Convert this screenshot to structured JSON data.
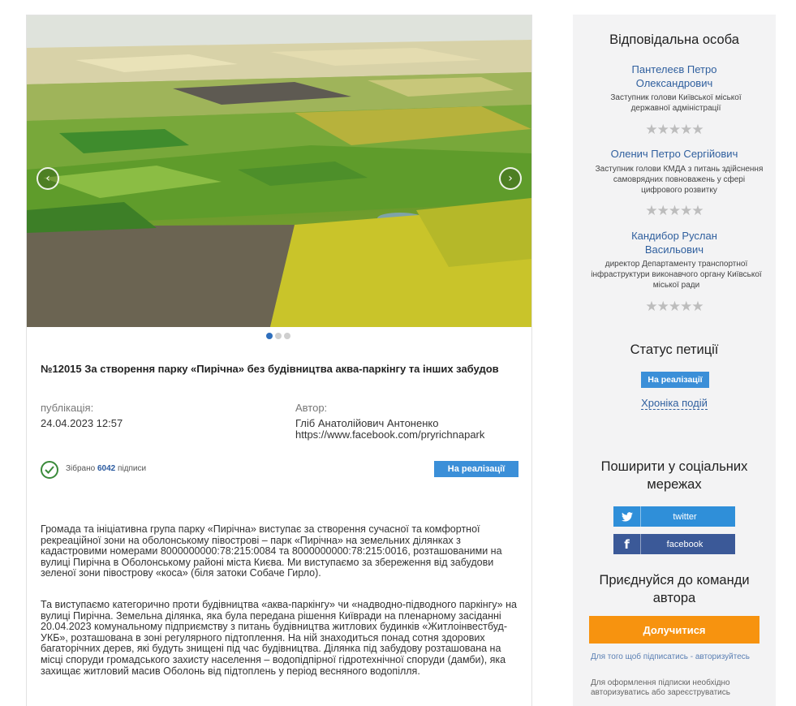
{
  "carousel": {
    "prev_icon": "chevron-left-icon",
    "next_icon": "chevron-right-icon",
    "slides_count": 3,
    "active_slide": 1
  },
  "petition": {
    "title": "№12015 За створення парку «Пирічна» без будівництва аква-паркінгу та інших забудов",
    "publication_label": "публікація:",
    "publication_date": "24.04.2023 12:57",
    "author_label": "Автор:",
    "author_name": "Гліб Анатолійович Антоненко",
    "author_link": "https://www.facebook.com/pryrichnapark",
    "collected_prefix": "Зібрано",
    "collected_count": "6042",
    "collected_suffix": "підписи",
    "status_button": "На реалізації",
    "paragraph_1": "Громада та ініціативна група парку «Пирічна» виступає за створення сучасної та комфортної рекреаційної зони на оболонському півострові – парк «Пирічна» на земельних ділянках з кадастровими номерами 8000000000:78:215:0084 та 8000000000:78:215:0016, розташованими на вулиці Пирічна в Оболонському районі міста Києва. Ми виступаємо за збереження від забудови зеленої зони півострову «коса» (біля затоки Собаче Гирло).",
    "paragraph_2": "Та виступаємо категорично проти будівництва «аква-паркінгу» чи «надводно-підводного паркінгу» на вулиці Пирічна. Земельна ділянка, яка була передана рішення Київради на пленарному засіданні 20.04.2023 комунальному підприємству з питань будівництва житлових будинків «Житлоінвестбуд-УКБ», розташована в зоні регулярного підтоплення. На ній знаходиться понад сотня здорових багаторічних дерев, які будуть знищені під час будівництва. Ділянка під забудову розташована на місці споруди громадського захисту населення – водопідпірної гідротехнічної споруди (дамби), яка захищає житловий масив Оболонь від підтоплень у період весняного водопілля."
  },
  "sidebar": {
    "responsible_heading": "Відповідальна особа",
    "persons": [
      {
        "name": "Пантелеєв Петро Олександрович",
        "role": "Заступник голови Київської міської державної адміністрації",
        "rating": 0
      },
      {
        "name": "Оленич Петро Сергійович",
        "role": "Заступник голови КМДА з питань здійснення самоврядних повноважень у сфері цифрового розвитку",
        "rating": 0
      },
      {
        "name": "Кандибор Руслан Васильович",
        "role": "директор Департаменту транспортної інфраструктури виконавчого органу Київської міської ради",
        "rating": 0
      }
    ],
    "stars_text": "★★★★★",
    "status_heading": "Статус петиції",
    "status_badge": "На реалізації",
    "chronicle_link": "Хроніка подій",
    "share_heading": "Поширити у соціальних мережах",
    "twitter_label": "twitter",
    "facebook_label": "facebook",
    "join_heading": "Приєднуйся до команди автора",
    "join_button": "Долучитися",
    "note_sign": "Для того щоб підписатись - авторизуйтесь",
    "note_auth": "Для оформлення підписки необхідно авторизуватись або зареєструватись"
  },
  "colors": {
    "link_blue": "#2f5f9e",
    "status_blue": "#3b8fd8",
    "twitter": "#2f8fd9",
    "facebook": "#3b5998",
    "join_orange": "#f7930f",
    "check_green": "#3a8a3a"
  }
}
